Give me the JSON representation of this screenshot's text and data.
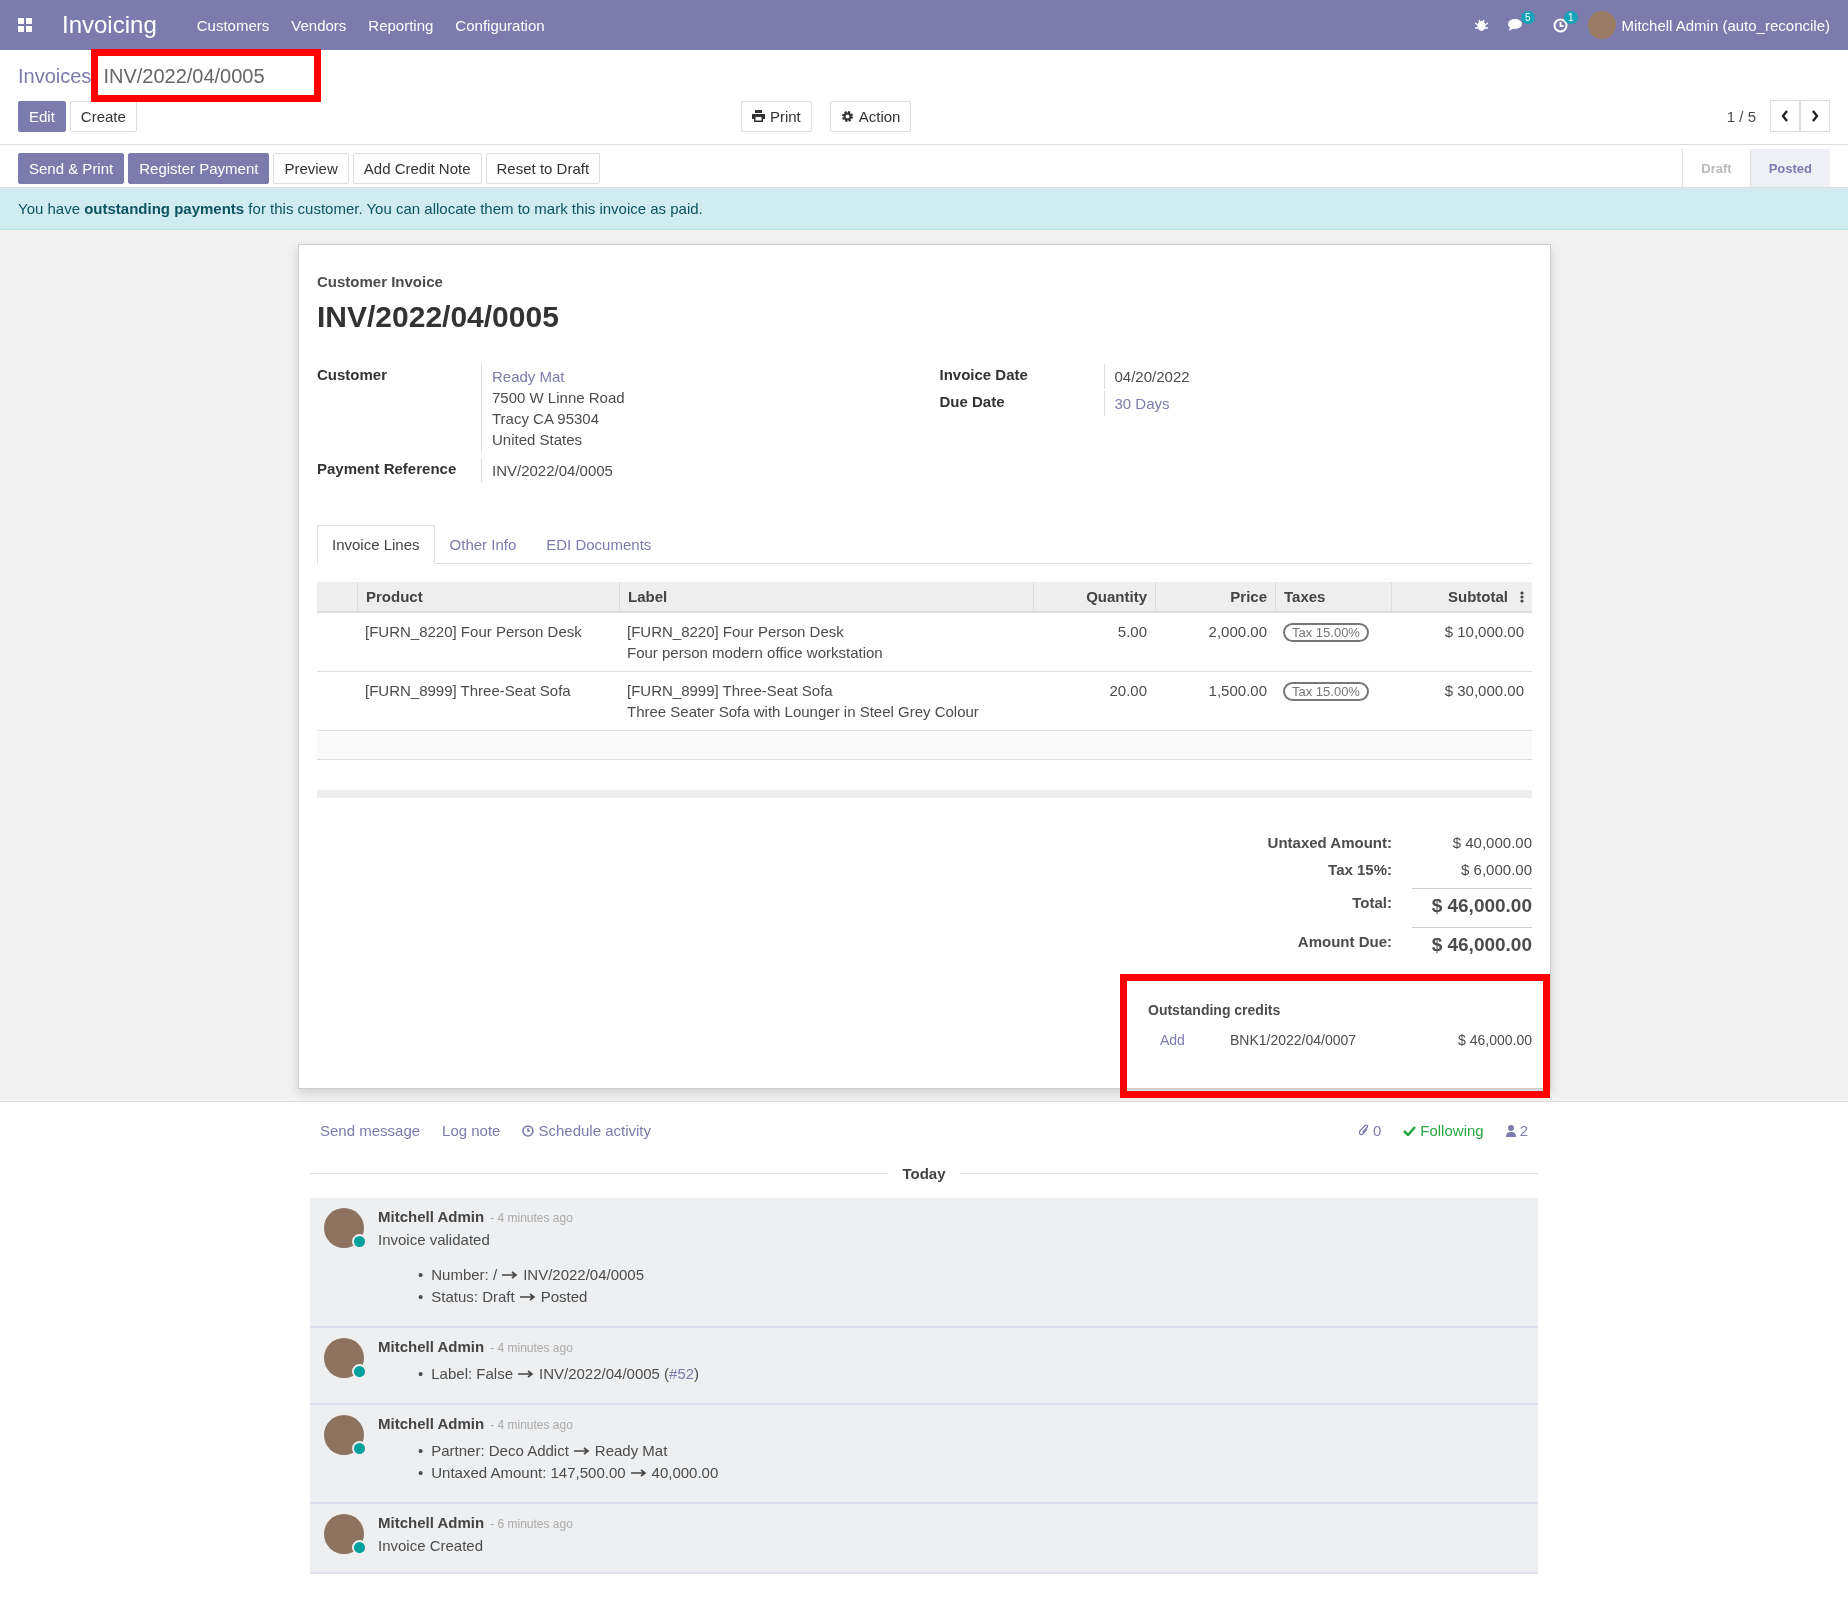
{
  "navbar": {
    "app_name": "Invoicing",
    "menu": [
      "Customers",
      "Vendors",
      "Reporting",
      "Configuration"
    ],
    "messages_count": "5",
    "activities_count": "1",
    "user": "Mitchell Admin (auto_reconcile)"
  },
  "breadcrumb": {
    "parent": "Invoices",
    "current": "INV/2022/04/0005",
    "highlighted": true
  },
  "control_buttons": [
    {
      "label": "Edit",
      "kind": "primary"
    },
    {
      "label": "Create",
      "kind": "secondary"
    }
  ],
  "toolbar_buttons": [
    {
      "label": "Print",
      "kind": "print"
    },
    {
      "label": "Action",
      "kind": "gear"
    }
  ],
  "pager": "1 / 5",
  "status_buttons": [
    {
      "label": "Send & Print",
      "kind": "primary"
    },
    {
      "label": "Register Payment",
      "kind": "primary"
    },
    {
      "label": "Preview",
      "kind": "secondary"
    },
    {
      "label": "Add Credit Note",
      "kind": "secondary"
    },
    {
      "label": "Reset to Draft",
      "kind": "secondary"
    }
  ],
  "status_steps": [
    {
      "label": "Draft",
      "selected": false
    },
    {
      "label": "Posted",
      "selected": true
    }
  ],
  "alert": "You have **outstanding payments** for this customer. You can allocate them to mark this invoice as paid.",
  "sheet": {
    "type_label": "Customer Invoice",
    "number": "INV/2022/04/0005",
    "customer": {
      "label": "Customer",
      "name": "Ready Mat",
      "address_lines": [
        "7500 W Linne Road",
        "Tracy CA 95304",
        "United States"
      ]
    },
    "payment_reference": {
      "label": "Payment Reference",
      "value": "INV/2022/04/0005"
    },
    "right_fields": [
      {
        "label": "Invoice Date",
        "value": "04/20/2022",
        "kind": "text"
      },
      {
        "label": "Due Date",
        "value": "30 Days",
        "kind": "link"
      }
    ],
    "tabs": [
      {
        "label": "Invoice Lines",
        "selected": true
      },
      {
        "label": "Other Info",
        "selected": false
      },
      {
        "label": "EDI Documents",
        "selected": false
      }
    ],
    "table": {
      "columns": [
        "Product",
        "Label",
        "Quantity",
        "Price",
        "Taxes",
        "Subtotal"
      ],
      "rows": [
        {
          "product": "[FURN_8220] Four Person Desk",
          "label": "[FURN_8220] Four Person Desk",
          "description": "Four person modern office workstation",
          "quantity": "5.00",
          "price": "2,000.00",
          "tax": "Tax 15.00%",
          "subtotal": "$ 10,000.00"
        },
        {
          "product": "[FURN_8999] Three-Seat Sofa",
          "label": "[FURN_8999] Three-Seat Sofa",
          "description": "Three Seater Sofa with Lounger in Steel Grey Colour",
          "quantity": "20.00",
          "price": "1,500.00",
          "tax": "Tax 15.00%",
          "subtotal": "$ 30,000.00"
        }
      ]
    },
    "totals": [
      {
        "label": "Untaxed Amount:",
        "value": "$ 40,000.00",
        "kind": "normal"
      },
      {
        "label": "Tax 15%:",
        "value": "$ 6,000.00",
        "kind": "normal"
      },
      {
        "label": "Total:",
        "value": "$ 46,000.00",
        "kind": "grand"
      },
      {
        "label": "Amount Due:",
        "value": "$ 46,000.00",
        "kind": "grand"
      }
    ],
    "outstanding": {
      "title": "Outstanding credits",
      "highlighted": true,
      "items": [
        {
          "action": "Add",
          "reference": "BNK1/2022/04/0007",
          "amount": "$ 46,000.00"
        }
      ]
    }
  },
  "chatter": {
    "actions": [
      {
        "label": "Send message",
        "kind": "plain"
      },
      {
        "label": "Log note",
        "kind": "plain"
      },
      {
        "label": "Schedule activity",
        "kind": "clock"
      }
    ],
    "attachments": "0",
    "following": "Following",
    "followers": "2",
    "date_separator": "Today",
    "messages": [
      {
        "author": "Mitchell Admin",
        "time": "- 4 minutes ago",
        "online": true,
        "body": "Invoice validated",
        "changes": [
          {
            "marker": "•",
            "before": "Number: /",
            "after": "INV/2022/04/0005"
          },
          {
            "marker": "•",
            "before": "Status: Draft",
            "after": "Posted"
          }
        ]
      },
      {
        "author": "Mitchell Admin",
        "time": "- 4 minutes ago",
        "online": true,
        "changes": [
          {
            "marker": "•",
            "before": "Label: False",
            "after": "INV/2022/04/0005 (",
            "link": "#52",
            "suffix": ")"
          }
        ]
      },
      {
        "author": "Mitchell Admin",
        "time": "- 4 minutes ago",
        "online": true,
        "changes": [
          {
            "marker": "•",
            "before": "Partner: Deco Addict",
            "after": "Ready Mat"
          },
          {
            "marker": "•",
            "before": "Untaxed Amount: 147,500.00",
            "after": "40,000.00"
          }
        ]
      },
      {
        "author": "Mitchell Admin",
        "time": "- 6 minutes ago",
        "online": true,
        "body": "Invoice Created"
      }
    ]
  }
}
